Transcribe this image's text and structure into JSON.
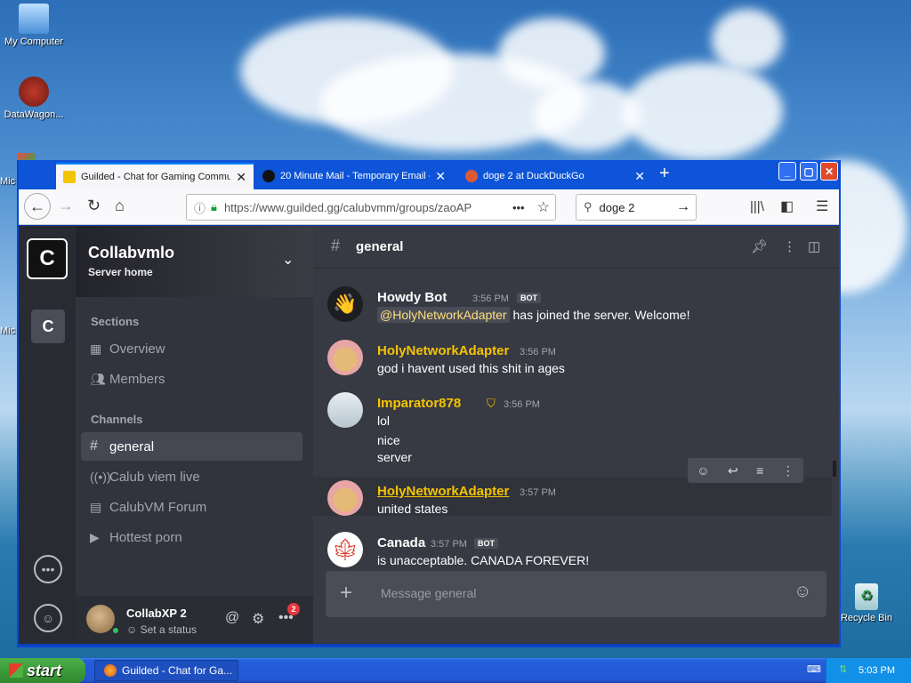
{
  "desktop": {
    "icons": [
      {
        "label": "My Computer"
      },
      {
        "label": "DataWagon..."
      },
      {
        "label": "Mic"
      },
      {
        "label": "Mic"
      },
      {
        "label": "Recycle Bin"
      }
    ]
  },
  "browser": {
    "tabs": [
      {
        "title": "Guilded - Chat for Gaming Commun",
        "active": true
      },
      {
        "title": "20 Minute Mail - Temporary Email -",
        "active": false
      },
      {
        "title": "doge 2 at DuckDuckGo",
        "active": false
      }
    ],
    "url": "https://www.guilded.gg/calubvmm/groups/zaoAP",
    "search": "doge 2",
    "more_label": "•••"
  },
  "guilded": {
    "rail": {
      "server_big": "C",
      "server_small": "C"
    },
    "server_name": "Collabvmlo",
    "server_home": "Server home",
    "sections_label": "Sections",
    "sections": [
      {
        "label": "Overview",
        "icon": "grid-icon"
      },
      {
        "label": "Members",
        "icon": "users-icon"
      }
    ],
    "channels_label": "Channels",
    "channels": [
      {
        "label": "general",
        "icon": "hash-icon",
        "active": true
      },
      {
        "label": "Calub viem live",
        "icon": "broadcast-icon"
      },
      {
        "label": "CalubVM Forum",
        "icon": "forum-icon"
      },
      {
        "label": "Hottest porn",
        "icon": "media-icon"
      }
    ],
    "user": {
      "name": "CollabXP 2",
      "status": "Set a status",
      "notif_count": "2"
    },
    "channel_title": "general",
    "messages": [
      {
        "author": "Howdy Bot",
        "time": "3:56 PM",
        "bot": "BOT",
        "mention": "@HolyNetworkAdapter",
        "text": "has joined the server. Welcome!"
      },
      {
        "author": "HolyNetworkAdapter",
        "time": "3:56 PM",
        "lines": [
          "god i havent used this shit in ages"
        ]
      },
      {
        "author": "Imparator878",
        "time": "3:56 PM",
        "lines": [
          "lol",
          "nice",
          "server"
        ]
      },
      {
        "author": "HolyNetworkAdapter",
        "time": "3:57 PM",
        "lines": [
          "united states"
        ]
      },
      {
        "author": "Canada",
        "time": "3:57 PM",
        "bot": "BOT",
        "lines": [
          "is unacceptable. CANADA FOREVER!"
        ]
      }
    ],
    "composer_placeholder": "Message general"
  },
  "taskbar": {
    "start_label": "start",
    "task_label": "Guilded - Chat for Ga...",
    "clock": "5:03 PM"
  },
  "colors": {
    "accent": "#f5c400",
    "app_bg": "#373943",
    "taskbar": "#245edb"
  }
}
